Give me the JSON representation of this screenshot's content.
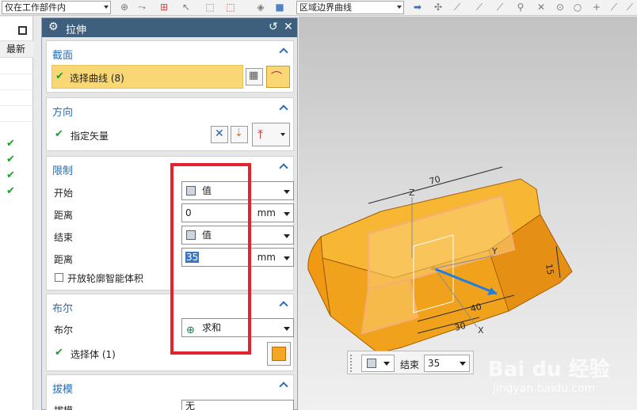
{
  "toolbar": {
    "filter_value": "仅在工作部件内",
    "curve_rule_value": "区域边界曲线"
  },
  "history": {
    "column_header": "最新",
    "check_glyph": "✔"
  },
  "dialog": {
    "title": "拉伸",
    "refresh_glyph": "↺",
    "close_glyph": "✕",
    "section": {
      "title": "截面",
      "select_label": "选择曲线 (8)"
    },
    "direction": {
      "title": "方向",
      "vector_label": "指定矢量"
    },
    "limits": {
      "title": "限制",
      "start_label": "开始",
      "start_value": "值",
      "start_dist_label": "距离",
      "start_dist_value": "0",
      "end_label": "结束",
      "end_value": "值",
      "end_dist_label": "距离",
      "end_dist_value": "35",
      "unit": "mm",
      "open_profile_label": "开放轮廓智能体积"
    },
    "boolean": {
      "title": "布尔",
      "bool_label": "布尔",
      "bool_value": "求和",
      "body_label": "选择体 (1)"
    },
    "draft": {
      "title": "拔模",
      "draft_label": "拔模",
      "draft_value": "无"
    }
  },
  "viewport": {
    "dimensions": [
      "70",
      "15",
      "40",
      "30"
    ],
    "axis_labels": [
      "Z",
      "Y",
      "X"
    ],
    "end_label": "结束",
    "end_value": "35"
  },
  "watermark": {
    "brand": "Bai du 经验",
    "url": "jingyan.baidu.com"
  },
  "colors": {
    "title_bar": "#3e5f7e",
    "section_head": "#2a6db4",
    "highlight": "#f8d774",
    "model": "#f0a21c",
    "red_annotation": "#e3232d"
  }
}
